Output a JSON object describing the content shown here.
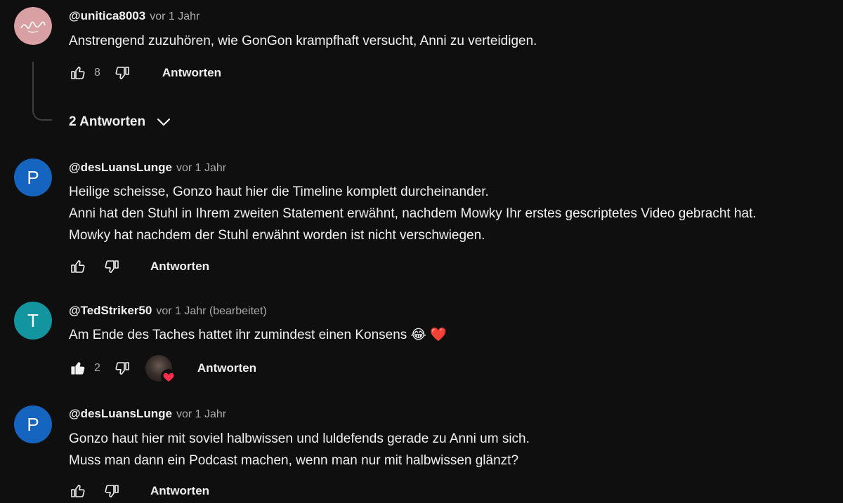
{
  "comments": [
    {
      "author": "@unitica8003",
      "time": "vor 1 Jahr",
      "avatar_letter": "",
      "avatar_color": "#d9a0a3",
      "lines": [
        "Anstrengend zuzuhören, wie GonGon krampfhaft versucht, Anni zu verteidigen."
      ],
      "likes": "8",
      "reply_label": "Antworten",
      "replies_toggle": "2 Antworten"
    },
    {
      "author": "@desLuansLunge",
      "time": "vor 1 Jahr",
      "avatar_letter": "P",
      "avatar_color": "#1565c0",
      "lines": [
        "Heilige scheisse, Gonzo haut hier die Timeline komplett durcheinander.",
        "Anni hat den Stuhl in Ihrem zweiten Statement erwähnt, nachdem Mowky Ihr erstes gescriptetes Video gebracht hat.",
        "Mowky hat nachdem der Stuhl erwähnt worden ist nicht verschwiegen."
      ],
      "likes": "",
      "reply_label": "Antworten"
    },
    {
      "author": "@TedStriker50",
      "time": "vor 1 Jahr (bearbeitet)",
      "avatar_letter": "T",
      "avatar_color": "#12959f",
      "lines": [
        "Am Ende des Taches hattet ihr zumindest einen Konsens 😂 ❤️"
      ],
      "likes": "2",
      "reply_label": "Antworten"
    },
    {
      "author": "@desLuansLunge",
      "time": "vor 1 Jahr",
      "avatar_letter": "P",
      "avatar_color": "#1565c0",
      "lines": [
        "Gonzo haut hier mit soviel halbwissen und luldefends gerade zu Anni um sich.",
        "Muss man dann ein Podcast machen, wenn man nur mit halbwissen glänzt?"
      ],
      "likes": "",
      "reply_label": "Antworten"
    }
  ],
  "colors": {
    "background": "#0f0f0f",
    "text": "#f1f1f1",
    "meta": "#aaaaaa",
    "heart": "#ff2e4c"
  }
}
